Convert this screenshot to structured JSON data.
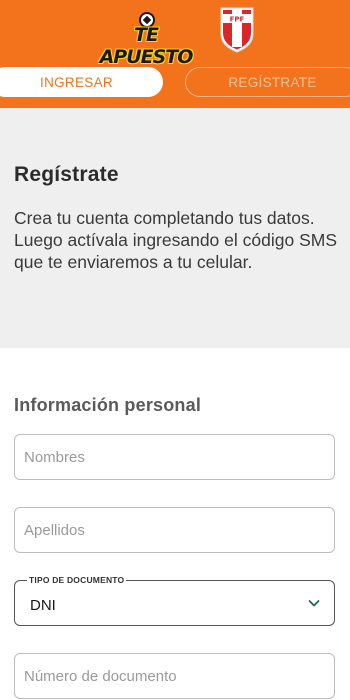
{
  "header": {
    "brand_logo": "TE APUESTO",
    "federation_crest": "FPF",
    "tabs": [
      {
        "label": "INGRESAR",
        "active": true
      },
      {
        "label": "REGÍSTRATE",
        "active": false
      }
    ],
    "colors": {
      "primary": "#f2731c"
    }
  },
  "intro": {
    "title": "Regístrate",
    "description": "Crea tu cuenta completando tus datos. Luego actívala ingresando el código SMS que te enviaremos a tu celular."
  },
  "form": {
    "section_title": "Información personal",
    "nombres_placeholder": "Nombres",
    "apellidos_placeholder": "Apellidos",
    "tipo_documento": {
      "label": "TIPO DE DOCUMENTO",
      "value": "DNI",
      "icon": "chevron-down-icon"
    },
    "numero_placeholder": "Número de documento"
  }
}
